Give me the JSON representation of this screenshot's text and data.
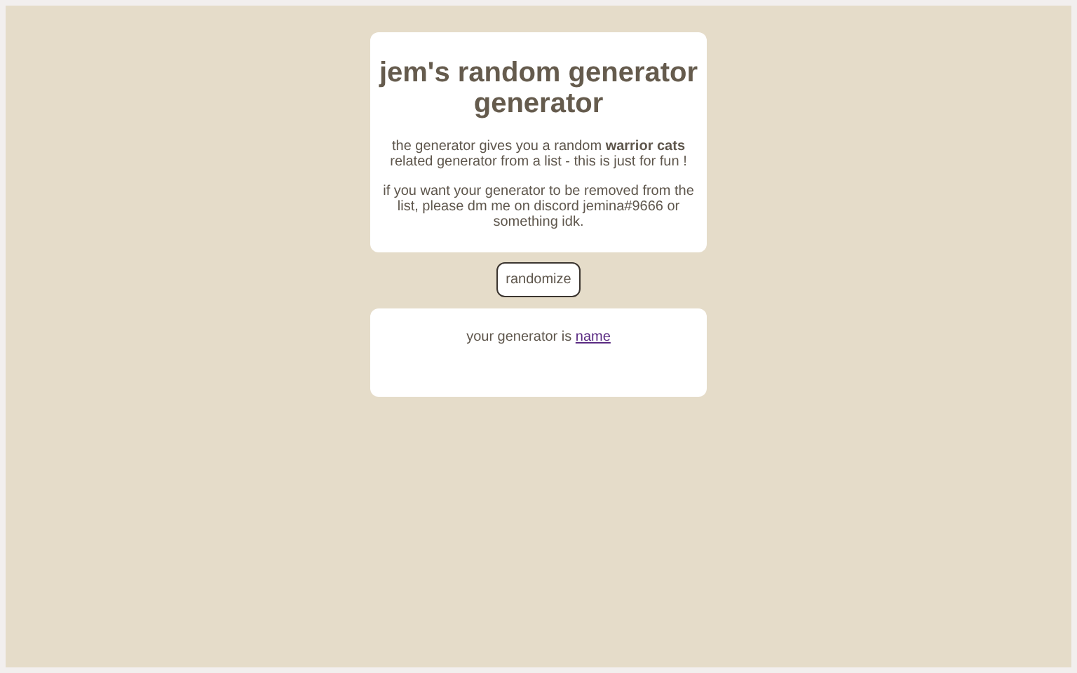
{
  "header": {
    "title": "jem's random generator generator",
    "paragraphs": [
      "the generator gives you a random **warrior cats** related generator from a list - this is just for fun !",
      "if you want your generator to be removed from the list, please dm me on discord jemina#9666 or something idk."
    ]
  },
  "button": {
    "label": "randomize"
  },
  "result": {
    "text": "your generator is",
    "link": "name"
  }
}
